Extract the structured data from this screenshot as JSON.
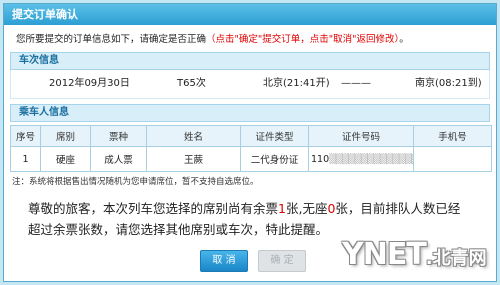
{
  "dialog": {
    "title": "提交订单确认"
  },
  "notice": {
    "prefix": "您所要提交的订单信息如下，请确定是否正确",
    "red": "（点击\"确定\"提交订单，点击\"取消\"返回修改）",
    "suffix": "。"
  },
  "train_section": {
    "title": "车次信息",
    "date": "2012年09月30日",
    "train_no": "T65次",
    "from": "北京(21:41开)",
    "separator": "———",
    "to": "南京(08:21到)"
  },
  "passenger_section": {
    "title": "乘车人信息",
    "headers": [
      "序号",
      "席别",
      "票种",
      "姓名",
      "证件类型",
      "证件号码",
      "手机号"
    ],
    "rows": [
      {
        "index": "1",
        "seat": "硬座",
        "ticket_type": "成人票",
        "name": "王蕨",
        "id_type": "二代身份证",
        "id_number": "110",
        "id_masked": "▒▒▒▒▒▒▒▒▒▒▒▒▒▒▒",
        "phone": ""
      }
    ]
  },
  "note": "注：系统将根据售出情况随机为您申请席位，暂不支持自选席位。",
  "warning": {
    "part1": "尊敬的旅客，本次列车您选择的席别尚有余票",
    "count1": "1",
    "part2": "张,无座",
    "count2": "0",
    "part3": "张，目前排队人数已经超过余票张数，请您选择其他席别或车次，特此提醒。"
  },
  "buttons": {
    "cancel": "取  消",
    "confirm": "确 定"
  },
  "watermark": {
    "latin": "YNET",
    "cn": ".北青网"
  }
}
